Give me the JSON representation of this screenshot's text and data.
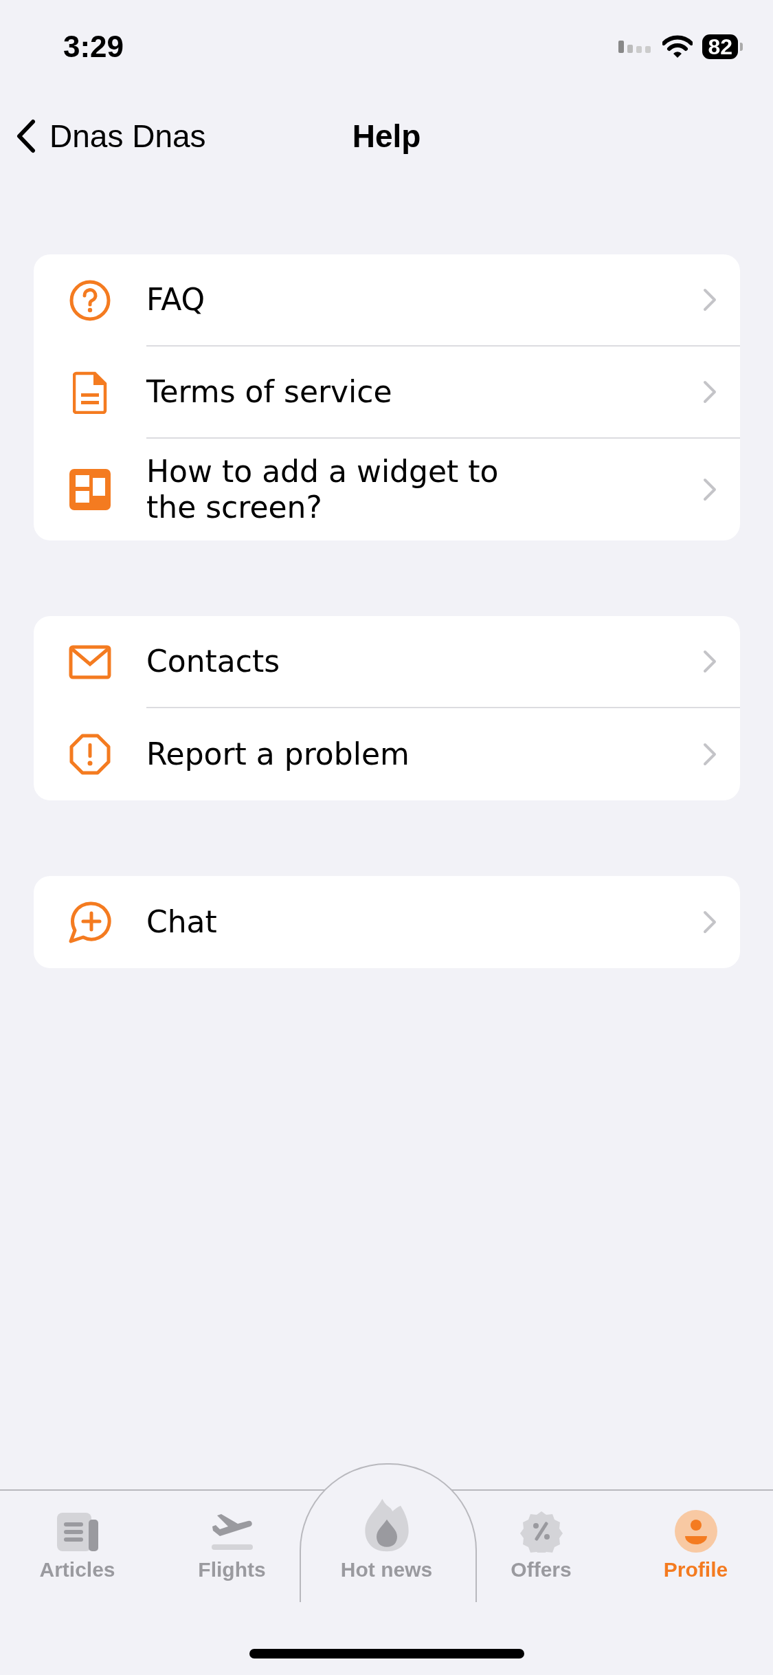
{
  "status_bar": {
    "time": "3:29",
    "battery": "82"
  },
  "nav": {
    "back_label": "Dnas Dnas",
    "title": "Help"
  },
  "groups": [
    {
      "items": [
        {
          "label": "FAQ"
        },
        {
          "label": "Terms of service"
        },
        {
          "label": "How to add a widget to\nthe screen?"
        }
      ]
    },
    {
      "items": [
        {
          "label": "Contacts"
        },
        {
          "label": "Report a problem"
        }
      ]
    },
    {
      "items": [
        {
          "label": "Chat"
        }
      ]
    }
  ],
  "tabs": [
    {
      "label": "Articles",
      "selected": false
    },
    {
      "label": "Flights",
      "selected": false
    },
    {
      "label": "Hot news",
      "selected": false
    },
    {
      "label": "Offers",
      "selected": false
    },
    {
      "label": "Profile",
      "selected": true
    }
  ]
}
